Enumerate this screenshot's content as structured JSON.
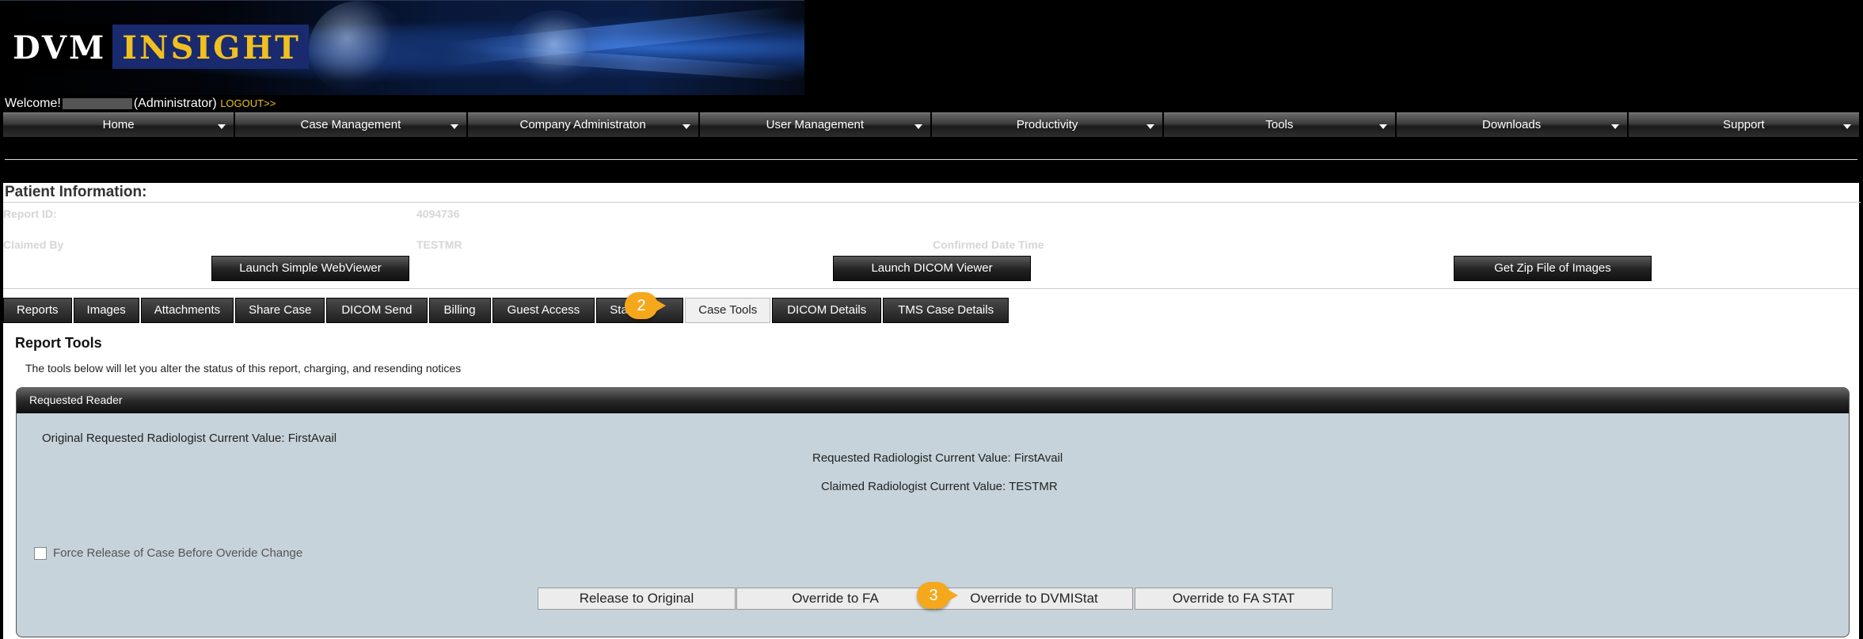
{
  "logo": {
    "part1": "DVM",
    "part2": "INSIGHT"
  },
  "welcome": {
    "prefix": "Welcome!",
    "role": "(Administrator)",
    "logout": "LOGOUT>>"
  },
  "nav": [
    "Home",
    "Case Management",
    "Company Administraton",
    "User Management",
    "Productivity",
    "Tools",
    "Downloads",
    "Support"
  ],
  "patient": {
    "title": "Patient Information:",
    "report_id_label": "Report ID:",
    "report_id_value": "4094736",
    "claimed_by_label": "Claimed By",
    "claimed_by_value": "TESTMR",
    "confirmed_label": "Confirmed Date Time"
  },
  "launch_buttons": [
    "Launch Simple WebViewer",
    "Launch DICOM Viewer",
    "Get Zip File of Images"
  ],
  "tabs": [
    "Reports",
    "Images",
    "Attachments",
    "Share Case",
    "DICOM Send",
    "Billing",
    "Guest Access",
    "Status",
    "Case Tools",
    "DICOM Details",
    "TMS Case Details"
  ],
  "active_tab": "Case Tools",
  "steps": {
    "two": "2",
    "three": "3"
  },
  "report_tools": {
    "title": "Report Tools",
    "description": "The tools below will let you alter the status of this report, charging, and resending notices"
  },
  "panel": {
    "header": "Requested Reader",
    "original": "Original Requested Radiologist Current Value: FirstAvail",
    "requested": "Requested Radiologist Current Value: FirstAvail",
    "claimed": "Claimed Radiologist Current Value: TESTMR",
    "force_label": "Force Release of Case Before Overide Change",
    "buttons": [
      "Release to Original",
      "Override to FA",
      "Override to DVMIStat",
      "Override to FA STAT"
    ]
  },
  "colors": {
    "accent": "#f5a81c",
    "logo_gold": "#f0c020",
    "panel_bg": "#c6d3da"
  }
}
